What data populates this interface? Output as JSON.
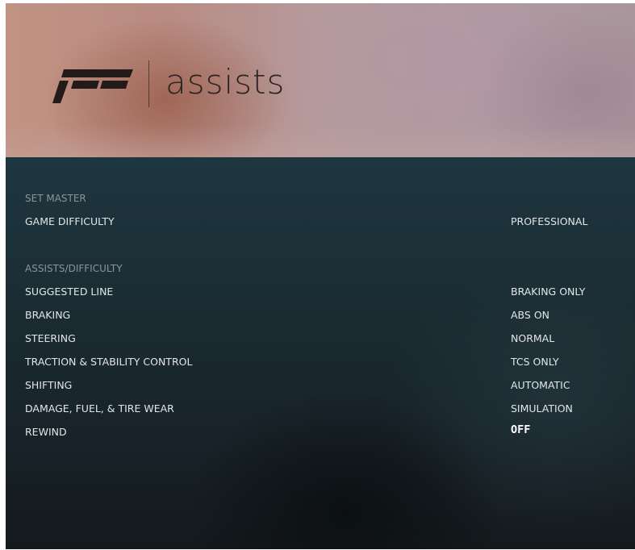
{
  "header": {
    "title": "assists",
    "logo_icon": "forza-motorsport-logo-icon"
  },
  "sections": [
    {
      "label": "SET MASTER",
      "rows": [
        {
          "label": "GAME DIFFICULTY",
          "value": "PROFESSIONAL"
        }
      ]
    },
    {
      "label": "ASSISTS/DIFFICULTY",
      "rows": [
        {
          "label": "SUGGESTED LINE",
          "value": "BRAKING ONLY"
        },
        {
          "label": "BRAKING",
          "value": "ABS ON"
        },
        {
          "label": "STEERING",
          "value": "NORMAL"
        },
        {
          "label": "TRACTION & STABILITY CONTROL",
          "value": "TCS ONLY"
        },
        {
          "label": "SHIFTING",
          "value": "AUTOMATIC"
        },
        {
          "label": "DAMAGE, FUEL, & TIRE WEAR",
          "value": "SIMULATION"
        },
        {
          "label": "REWIND",
          "value": "OFF"
        }
      ]
    }
  ],
  "colors": {
    "header_tint": "#b8969a",
    "panel_bg": "#1b2d34",
    "text": "#e2e6e7",
    "section_label": "#8a9599"
  }
}
